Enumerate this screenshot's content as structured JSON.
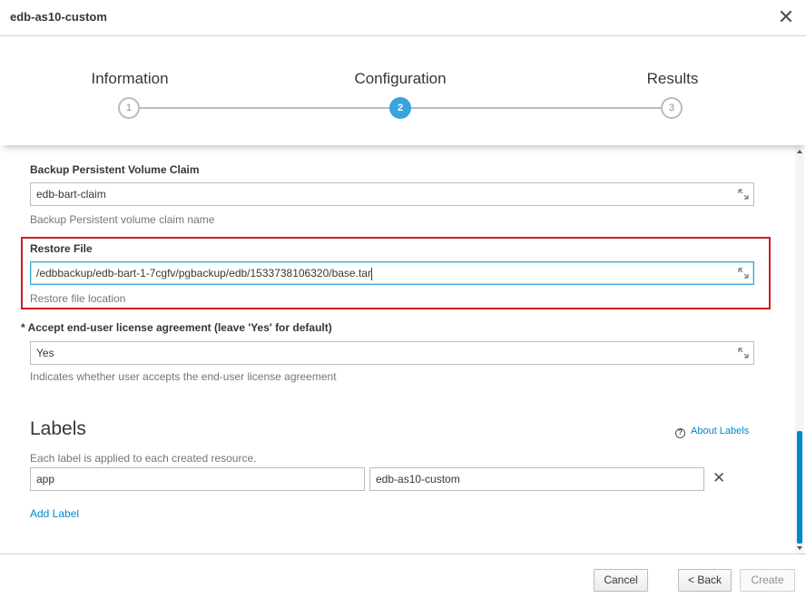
{
  "modal": {
    "title": "edb-as10-custom"
  },
  "wizard": {
    "steps": [
      {
        "label": "Information",
        "number": "1"
      },
      {
        "label": "Configuration",
        "number": "2"
      },
      {
        "label": "Results",
        "number": "3"
      }
    ],
    "active_step": 2
  },
  "form": {
    "backup_pvc": {
      "label": "Backup Persistent Volume Claim",
      "value": "edb-bart-claim",
      "help": "Backup Persistent volume claim name"
    },
    "restore_file": {
      "label": "Restore File",
      "value": "/edbbackup/edb-bart-1-7cgfv/pgbackup/edb/1533738106320/base.tar",
      "help": "Restore file location"
    },
    "eula": {
      "required_marker": "*",
      "label": "Accept end-user license agreement (leave 'Yes' for default)",
      "value": "Yes",
      "help": "Indicates whether user accepts the end-user license agreement"
    }
  },
  "labels": {
    "title": "Labels",
    "about_link": "About Labels",
    "help": "Each label is applied to each created resource.",
    "rows": [
      {
        "key": "app",
        "value": "edb-as10-custom"
      }
    ],
    "add_label": "Add Label"
  },
  "footer": {
    "cancel": "Cancel",
    "back": "< Back",
    "create": "Create"
  },
  "colors": {
    "accent": "#39a5dc",
    "link": "#0088ce",
    "highlight": "#cc1f1f",
    "border": "#bbbbbb"
  }
}
